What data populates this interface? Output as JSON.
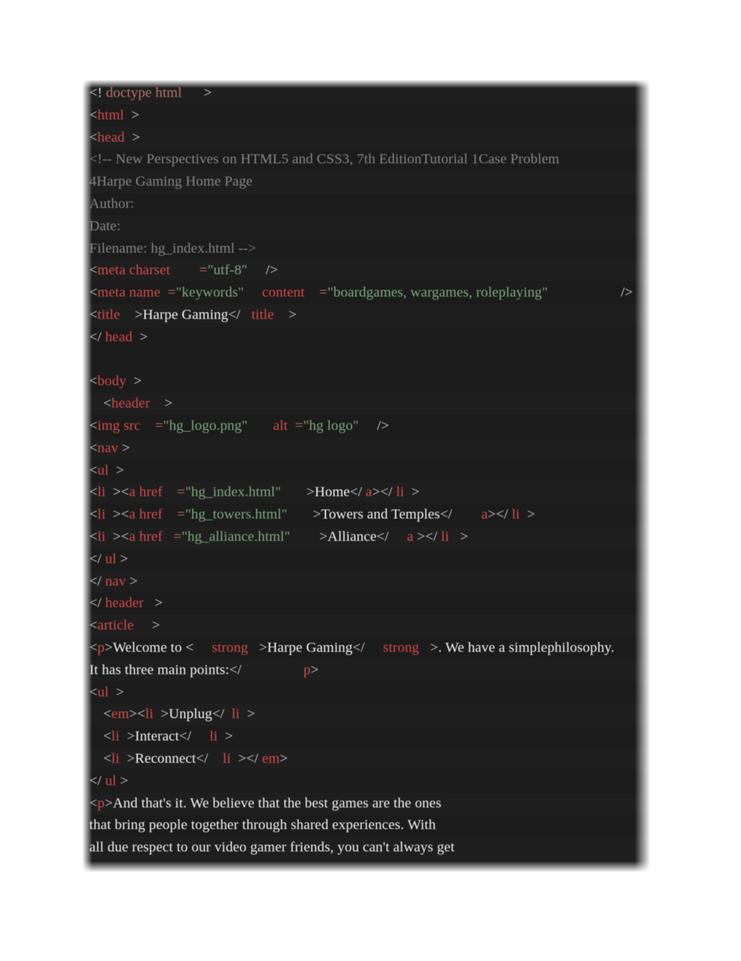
{
  "document": {
    "kind": "html-source-listing",
    "filename": "hg_index.html",
    "title": "Harpe Gaming",
    "theme": {
      "background": "#1e1e1e",
      "tag_color": "#d64b4b",
      "attribute_value_color": "#7fa87f",
      "text_color": "#f2f2f2",
      "comment_color": "#868686",
      "doctype_color": "#b5766a",
      "punctuation_color": "#d8d8d8"
    }
  },
  "code": {
    "lines": [
      {
        "id": "l1",
        "indent": 0,
        "tokens": [
          {
            "t": "punc",
            "v": "<!"
          },
          {
            "t": "doctype",
            "v": " doctype html"
          },
          {
            "t": "punc",
            "v": "      >"
          }
        ]
      },
      {
        "id": "l2",
        "indent": 0,
        "tokens": [
          {
            "t": "punc",
            "v": "<"
          },
          {
            "t": "tag",
            "v": "html"
          },
          {
            "t": "punc",
            "v": "  >"
          }
        ]
      },
      {
        "id": "l3",
        "indent": 0,
        "tokens": [
          {
            "t": "punc",
            "v": "<"
          },
          {
            "t": "tag",
            "v": "head"
          },
          {
            "t": "punc",
            "v": "  >"
          }
        ]
      },
      {
        "id": "l4",
        "indent": 0,
        "tokens": [
          {
            "t": "comment",
            "v": "<!-- New Perspectives on HTML5 and CSS3, 7th EditionTutorial 1Case Problem"
          }
        ]
      },
      {
        "id": "l5",
        "indent": 0,
        "tokens": [
          {
            "t": "comment",
            "v": "4Harpe Gaming Home Page"
          }
        ]
      },
      {
        "id": "l6",
        "indent": 0,
        "tokens": [
          {
            "t": "comment",
            "v": "Author:"
          }
        ]
      },
      {
        "id": "l7",
        "indent": 0,
        "tokens": [
          {
            "t": "comment",
            "v": "Date:"
          }
        ]
      },
      {
        "id": "l8",
        "indent": 0,
        "tokens": [
          {
            "t": "comment",
            "v": "Filename: hg_index.html -->"
          }
        ]
      },
      {
        "id": "l9",
        "indent": 0,
        "tokens": [
          {
            "t": "punc",
            "v": "<"
          },
          {
            "t": "tag",
            "v": "meta charset"
          },
          {
            "t": "eq",
            "v": "        ="
          },
          {
            "t": "val",
            "v": "\"utf-8\""
          },
          {
            "t": "punc",
            "v": "     />"
          }
        ]
      },
      {
        "id": "l10",
        "indent": 0,
        "tokens": [
          {
            "t": "punc",
            "v": "<"
          },
          {
            "t": "tag",
            "v": "meta name"
          },
          {
            "t": "eq",
            "v": "  ="
          },
          {
            "t": "val",
            "v": "\"keywords\""
          },
          {
            "t": "punc",
            "v": "     "
          },
          {
            "t": "attr",
            "v": "content"
          },
          {
            "t": "eq",
            "v": "    ="
          },
          {
            "t": "val",
            "v": "\"boardgames, wargames, roleplaying\""
          },
          {
            "t": "punc",
            "v": "                    />"
          }
        ]
      },
      {
        "id": "l11",
        "indent": 0,
        "tokens": [
          {
            "t": "punc",
            "v": "<"
          },
          {
            "t": "tag",
            "v": "title"
          },
          {
            "t": "punc",
            "v": "    >"
          },
          {
            "t": "txt",
            "v": "Harpe Gaming"
          },
          {
            "t": "punc",
            "v": "</"
          },
          {
            "t": "tag",
            "v": "   title"
          },
          {
            "t": "punc",
            "v": "    >"
          }
        ]
      },
      {
        "id": "l12",
        "indent": 0,
        "tokens": [
          {
            "t": "punc",
            "v": "</"
          },
          {
            "t": "tag",
            "v": " head"
          },
          {
            "t": "punc",
            "v": "  >"
          }
        ]
      },
      {
        "id": "l13",
        "indent": 0,
        "blank": true,
        "tokens": []
      },
      {
        "id": "l14",
        "indent": 0,
        "tokens": [
          {
            "t": "punc",
            "v": "<"
          },
          {
            "t": "tag",
            "v": "body"
          },
          {
            "t": "punc",
            "v": "  >"
          }
        ]
      },
      {
        "id": "l15",
        "indent": 1,
        "tokens": [
          {
            "t": "punc",
            "v": "<"
          },
          {
            "t": "tag",
            "v": "header"
          },
          {
            "t": "punc",
            "v": "    >"
          }
        ]
      },
      {
        "id": "l16",
        "indent": 0,
        "tokens": [
          {
            "t": "punc",
            "v": "<"
          },
          {
            "t": "tag",
            "v": "img src"
          },
          {
            "t": "eq",
            "v": "    ="
          },
          {
            "t": "val",
            "v": "\"hg_logo.png\""
          },
          {
            "t": "punc",
            "v": "       "
          },
          {
            "t": "attr",
            "v": "alt"
          },
          {
            "t": "eq",
            "v": "  ="
          },
          {
            "t": "val",
            "v": "\"hg logo\""
          },
          {
            "t": "punc",
            "v": "     />"
          }
        ]
      },
      {
        "id": "l17",
        "indent": 0,
        "tokens": [
          {
            "t": "punc",
            "v": "<"
          },
          {
            "t": "tag",
            "v": "nav"
          },
          {
            "t": "punc",
            "v": " >"
          }
        ]
      },
      {
        "id": "l18",
        "indent": 0,
        "tokens": [
          {
            "t": "punc",
            "v": "<"
          },
          {
            "t": "tag",
            "v": "ul"
          },
          {
            "t": "punc",
            "v": "  >"
          }
        ]
      },
      {
        "id": "l19",
        "indent": 0,
        "tokens": [
          {
            "t": "punc",
            "v": "<"
          },
          {
            "t": "tag",
            "v": "li"
          },
          {
            "t": "punc",
            "v": "  ><"
          },
          {
            "t": "tag",
            "v": "a href"
          },
          {
            "t": "eq",
            "v": "    ="
          },
          {
            "t": "val",
            "v": "\"hg_index.html\""
          },
          {
            "t": "punc",
            "v": "       >"
          },
          {
            "t": "txt",
            "v": "Home"
          },
          {
            "t": "punc",
            "v": "</"
          },
          {
            "t": "tag",
            "v": " a"
          },
          {
            "t": "punc",
            "v": "></"
          },
          {
            "t": "tag",
            "v": " li"
          },
          {
            "t": "punc",
            "v": "  >"
          }
        ]
      },
      {
        "id": "l20",
        "indent": 0,
        "tokens": [
          {
            "t": "punc",
            "v": "<"
          },
          {
            "t": "tag",
            "v": "li"
          },
          {
            "t": "punc",
            "v": "  ><"
          },
          {
            "t": "tag",
            "v": "a href"
          },
          {
            "t": "eq",
            "v": "    ="
          },
          {
            "t": "val",
            "v": "\"hg_towers.html\""
          },
          {
            "t": "punc",
            "v": "       >"
          },
          {
            "t": "txt",
            "v": "Towers and Temples"
          },
          {
            "t": "punc",
            "v": "</"
          },
          {
            "t": "tag",
            "v": "        a"
          },
          {
            "t": "punc",
            "v": "></"
          },
          {
            "t": "tag",
            "v": " li"
          },
          {
            "t": "punc",
            "v": "  >"
          }
        ]
      },
      {
        "id": "l21",
        "indent": 0,
        "tokens": [
          {
            "t": "punc",
            "v": "<"
          },
          {
            "t": "tag",
            "v": "li"
          },
          {
            "t": "punc",
            "v": "  ><"
          },
          {
            "t": "tag",
            "v": "a href"
          },
          {
            "t": "eq",
            "v": "   ="
          },
          {
            "t": "val",
            "v": "\"hg_alliance.html\""
          },
          {
            "t": "punc",
            "v": "        >"
          },
          {
            "t": "txt",
            "v": "Alliance"
          },
          {
            "t": "punc",
            "v": "</"
          },
          {
            "t": "tag",
            "v": "     a"
          },
          {
            "t": "punc",
            "v": " ></"
          },
          {
            "t": "tag",
            "v": " li"
          },
          {
            "t": "punc",
            "v": "   >"
          }
        ]
      },
      {
        "id": "l22",
        "indent": 0,
        "tokens": [
          {
            "t": "punc",
            "v": "</"
          },
          {
            "t": "tag",
            "v": " ul"
          },
          {
            "t": "punc",
            "v": " >"
          }
        ]
      },
      {
        "id": "l23",
        "indent": 0,
        "tokens": [
          {
            "t": "punc",
            "v": "</"
          },
          {
            "t": "tag",
            "v": " nav"
          },
          {
            "t": "punc",
            "v": " >"
          }
        ]
      },
      {
        "id": "l24",
        "indent": 0,
        "tokens": [
          {
            "t": "punc",
            "v": "</"
          },
          {
            "t": "tag",
            "v": " header"
          },
          {
            "t": "punc",
            "v": "   >"
          }
        ]
      },
      {
        "id": "l25",
        "indent": 0,
        "tokens": [
          {
            "t": "punc",
            "v": "<"
          },
          {
            "t": "tag",
            "v": "article"
          },
          {
            "t": "punc",
            "v": "     >"
          }
        ]
      },
      {
        "id": "l26",
        "indent": 0,
        "tokens": [
          {
            "t": "punc",
            "v": "<"
          },
          {
            "t": "tag",
            "v": "p"
          },
          {
            "t": "punc",
            "v": ">"
          },
          {
            "t": "txt",
            "v": "Welcome to <"
          },
          {
            "t": "tag",
            "v": "     strong"
          },
          {
            "t": "punc",
            "v": "   >"
          },
          {
            "t": "txt",
            "v": "Harpe Gaming"
          },
          {
            "t": "punc",
            "v": "</"
          },
          {
            "t": "tag",
            "v": "     strong"
          },
          {
            "t": "punc",
            "v": "   >"
          },
          {
            "t": "txt",
            "v": ". We have a simplephilosophy."
          }
        ]
      },
      {
        "id": "l27",
        "indent": 0,
        "tokens": [
          {
            "t": "txt",
            "v": "It has three main points:"
          },
          {
            "t": "punc",
            "v": "</"
          },
          {
            "t": "tag",
            "v": "                 p"
          },
          {
            "t": "punc",
            "v": ">"
          }
        ]
      },
      {
        "id": "l28",
        "indent": 0,
        "tokens": [
          {
            "t": "punc",
            "v": "<"
          },
          {
            "t": "tag",
            "v": "ul"
          },
          {
            "t": "punc",
            "v": "  >"
          }
        ]
      },
      {
        "id": "l29",
        "indent": 1,
        "tokens": [
          {
            "t": "punc",
            "v": "<"
          },
          {
            "t": "tag",
            "v": "em"
          },
          {
            "t": "punc",
            "v": "><"
          },
          {
            "t": "tag",
            "v": "li"
          },
          {
            "t": "punc",
            "v": "  >"
          },
          {
            "t": "txt",
            "v": "Unplug"
          },
          {
            "t": "punc",
            "v": "</"
          },
          {
            "t": "tag",
            "v": "  li"
          },
          {
            "t": "punc",
            "v": "  >"
          }
        ]
      },
      {
        "id": "l30",
        "indent": 1,
        "tokens": [
          {
            "t": "punc",
            "v": "<"
          },
          {
            "t": "tag",
            "v": "li"
          },
          {
            "t": "punc",
            "v": "  >"
          },
          {
            "t": "txt",
            "v": "Interact"
          },
          {
            "t": "punc",
            "v": "</"
          },
          {
            "t": "tag",
            "v": "     li"
          },
          {
            "t": "punc",
            "v": "  >"
          }
        ]
      },
      {
        "id": "l31",
        "indent": 1,
        "tokens": [
          {
            "t": "punc",
            "v": "<"
          },
          {
            "t": "tag",
            "v": "li"
          },
          {
            "t": "punc",
            "v": "  >"
          },
          {
            "t": "txt",
            "v": "Reconnect"
          },
          {
            "t": "punc",
            "v": "</"
          },
          {
            "t": "tag",
            "v": "    li"
          },
          {
            "t": "punc",
            "v": "  ></"
          },
          {
            "t": "tag",
            "v": " em"
          },
          {
            "t": "punc",
            "v": ">"
          }
        ]
      },
      {
        "id": "l32",
        "indent": 0,
        "tokens": [
          {
            "t": "punc",
            "v": "</"
          },
          {
            "t": "tag",
            "v": " ul"
          },
          {
            "t": "punc",
            "v": " >"
          }
        ]
      },
      {
        "id": "l33",
        "indent": 0,
        "tokens": [
          {
            "t": "punc",
            "v": "<"
          },
          {
            "t": "tag",
            "v": "p"
          },
          {
            "t": "punc",
            "v": ">"
          },
          {
            "t": "txt",
            "v": "And that's it. We believe that the best games are the ones"
          }
        ]
      },
      {
        "id": "l34",
        "indent": 0,
        "tokens": [
          {
            "t": "txt",
            "v": "that bring people together through shared experiences. With"
          }
        ]
      },
      {
        "id": "l35",
        "indent": 0,
        "tokens": [
          {
            "t": "txt",
            "v": "all due respect to our video gamer friends, you can't always get"
          }
        ]
      }
    ]
  }
}
